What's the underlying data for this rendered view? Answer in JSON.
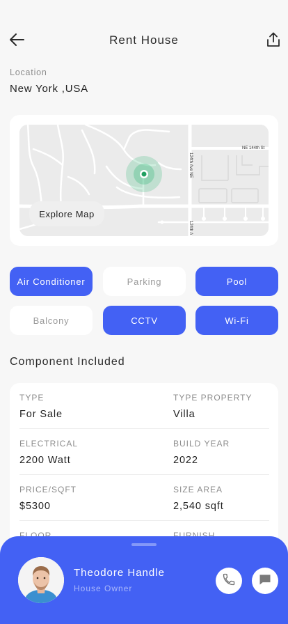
{
  "header": {
    "title": "Rent House",
    "back_icon": "arrow-left-icon",
    "share_icon": "share-upload-icon"
  },
  "location": {
    "label": "Location",
    "value": "New York ,USA"
  },
  "map": {
    "explore_label": "Explore Map",
    "streets": [
      "NE 144th St",
      "124th Ave NE",
      "124th A"
    ],
    "marker_color": "#2bb673"
  },
  "amenities": [
    {
      "label": "Air Conditioner",
      "selected": true
    },
    {
      "label": "Parking",
      "selected": false
    },
    {
      "label": "Pool",
      "selected": true
    },
    {
      "label": "Balcony",
      "selected": false
    },
    {
      "label": "CCTV",
      "selected": true
    },
    {
      "label": "Wi-Fi",
      "selected": true
    }
  ],
  "components": {
    "title": "Component Included",
    "rows": [
      {
        "left": {
          "label": "TYPE",
          "value": "For Sale"
        },
        "right": {
          "label": "TYPE PROPERTY",
          "value": "Villa"
        }
      },
      {
        "left": {
          "label": "ELECTRICAL",
          "value": "2200 Watt"
        },
        "right": {
          "label": "BUILD YEAR",
          "value": "2022"
        }
      },
      {
        "left": {
          "label": "PRICE/SQFT",
          "value": "$5300"
        },
        "right": {
          "label": "SIZE AREA",
          "value": "2,540 sqft"
        }
      },
      {
        "left": {
          "label": "FLOOR",
          "value": ""
        },
        "right": {
          "label": "FURNISH",
          "value": ""
        }
      }
    ]
  },
  "owner": {
    "name": "Theodore Handle",
    "role": "House Owner",
    "call_icon": "phone-icon",
    "message_icon": "chat-bubble-icon"
  },
  "colors": {
    "accent": "#4361f4",
    "background": "#f7f7f7",
    "card": "#ffffff"
  }
}
